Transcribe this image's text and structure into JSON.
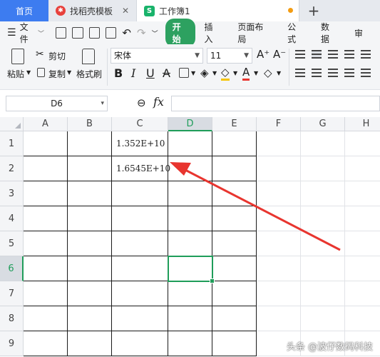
{
  "tabs": {
    "home": "首页",
    "doc1": "找稻壳模板",
    "doc2": "工作簿1",
    "new_tab": "+"
  },
  "menu": {
    "file": "文件",
    "start": "开始",
    "items": [
      "插入",
      "页面布局",
      "公式",
      "数据",
      "审"
    ]
  },
  "ribbon": {
    "paste": "粘贴",
    "cut": "剪切",
    "copy": "复制",
    "format_painter": "格式刷",
    "font_name": "宋体",
    "font_size": "11",
    "increase_font": "A⁺",
    "decrease_font": "A⁻",
    "bold": "B",
    "italic": "I",
    "underline": "U",
    "strike": "A"
  },
  "formula_bar": {
    "name_box": "D6",
    "fx": "fx",
    "value": ""
  },
  "sheet": {
    "columns": [
      "A",
      "B",
      "C",
      "D",
      "E",
      "F",
      "G",
      "H"
    ],
    "rows": [
      "1",
      "2",
      "3",
      "4",
      "5",
      "6",
      "7",
      "8",
      "9"
    ],
    "active_column": "D",
    "active_row": "6",
    "cells": {
      "C1": "1.352E+10",
      "C2": "1.6545E+10"
    }
  },
  "annotation": {
    "arrow_color": "#e8352f"
  },
  "watermark": "头条 @波仔数码科技",
  "colors": {
    "accent_green": "#1f9d5a",
    "home_tab_blue": "#3d7cf0",
    "start_button": "#2da160"
  }
}
